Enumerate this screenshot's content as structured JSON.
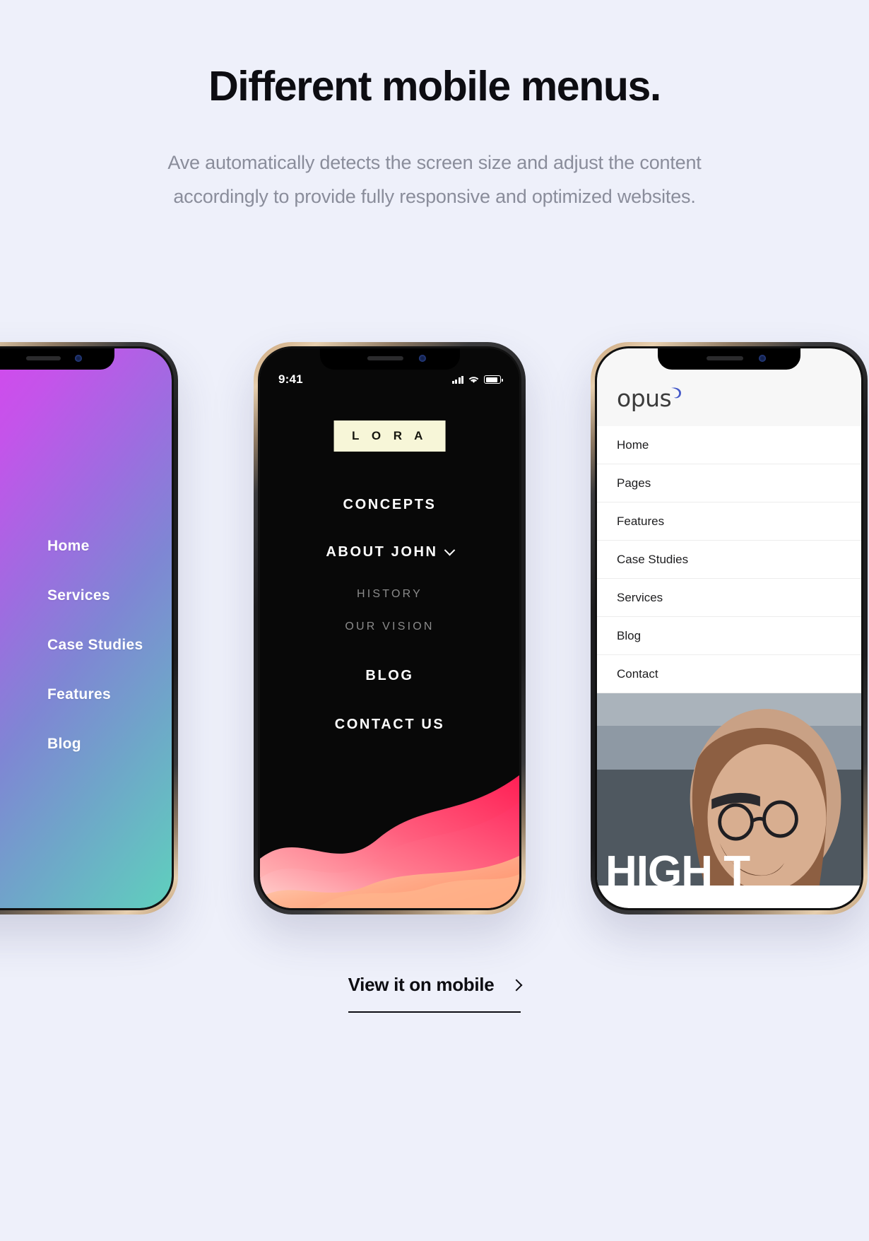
{
  "header": {
    "title": "Different mobile menus.",
    "subtitle": "Ave automatically detects the screen size and adjust the content accordingly to provide fully responsive and optimized websites."
  },
  "colors": {
    "page_background": "#eef0fa",
    "title": "#0d0d12",
    "subtitle": "#8a8d9b",
    "gradient_start": "#e040f0",
    "gradient_end": "#5fd0bd",
    "lora_logo_bg": "#f7f6d8",
    "dark_screen": "#080808",
    "opus_accent": "#4458c8",
    "wave_pink": "#ff3b6b",
    "wave_orange": "#ff9a6c"
  },
  "phones": [
    {
      "id": "gradient-menu-phone",
      "menu_items": [
        "Home",
        "Services",
        "Case Studies",
        "Features",
        "Blog"
      ]
    },
    {
      "id": "lora-menu-phone",
      "status_bar": {
        "time": "9:41",
        "signal": "signal-icon",
        "wifi": "wifi-icon",
        "battery": "battery-icon"
      },
      "logo": "L O R A",
      "menu_items": [
        {
          "label": "CONCEPTS",
          "type": "main",
          "has_chevron": false
        },
        {
          "label": "ABOUT JOHN",
          "type": "main",
          "has_chevron": true
        },
        {
          "label": "HISTORY",
          "type": "sub",
          "has_chevron": false
        },
        {
          "label": "OUR VISION",
          "type": "sub",
          "has_chevron": false
        },
        {
          "label": "BLOG",
          "type": "main",
          "has_chevron": false
        },
        {
          "label": "CONTACT US",
          "type": "main",
          "has_chevron": false
        }
      ]
    },
    {
      "id": "opus-menu-phone",
      "logo": "opus",
      "menu_items": [
        "Home",
        "Pages",
        "Features",
        "Case Studies",
        "Services",
        "Blog",
        "Contact"
      ],
      "hero_text": "HIGH T"
    }
  ],
  "cta": {
    "label": "View it on mobile",
    "arrow_icon": "chevron-right-icon"
  }
}
